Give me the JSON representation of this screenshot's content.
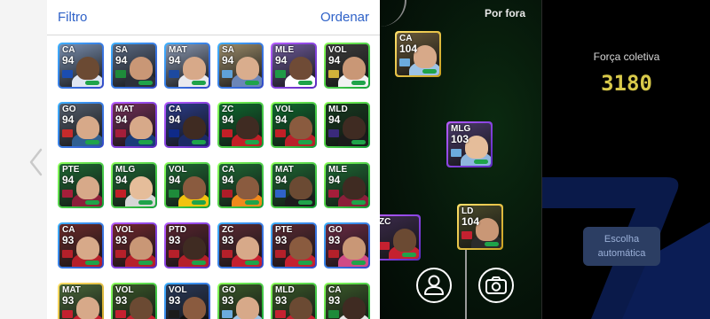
{
  "header": {
    "filter_label": "Filtro",
    "sort_label": "Ordenar"
  },
  "picker": {
    "cards": [
      {
        "pos": "CA",
        "ovr": "94",
        "border": "bd-blue",
        "bg": "#7a8fb0",
        "skin": "#6b4a33",
        "shirt": "#dfe6f2",
        "badge": "#1b4db1"
      },
      {
        "pos": "SA",
        "ovr": "94",
        "border": "bd-blue",
        "bg": "#5b6a83",
        "skin": "#c99776",
        "shirt": "#2b2f3a",
        "badge": "#1e8b3a"
      },
      {
        "pos": "MAT",
        "ovr": "94",
        "border": "bd-blue",
        "bg": "#8b99b3",
        "skin": "#d7a989",
        "shirt": "#e9e9ee",
        "badge": "#1d4aa0"
      },
      {
        "pos": "SA",
        "ovr": "94",
        "border": "bd-blue",
        "bg": "#9c8c6a",
        "skin": "#d9ad8d",
        "shirt": "#6b86b8",
        "badge": "#5fa2d8"
      },
      {
        "pos": "MLE",
        "ovr": "94",
        "border": "bd-purple",
        "bg": "#6f5b9c",
        "skin": "#6f4b36",
        "shirt": "#ffffff",
        "badge": "#1f9a46"
      },
      {
        "pos": "VOL",
        "ovr": "94",
        "border": "bd-green",
        "bg": "#3d3d3d",
        "skin": "#c99776",
        "shirt": "#f2f2f2",
        "badge": "#d1b13a"
      },
      {
        "pos": "GO",
        "ovr": "94",
        "border": "bd-blue",
        "bg": "#555f6e",
        "skin": "#d7a989",
        "shirt": "#2f5f91",
        "badge": "#c62b2b"
      },
      {
        "pos": "MAT",
        "ovr": "94",
        "border": "bd-purple",
        "bg": "#743059",
        "skin": "#d7a989",
        "shirt": "#1a3c7a",
        "badge": "#a41e3a"
      },
      {
        "pos": "CA",
        "ovr": "94",
        "border": "bd-purple",
        "bg": "#2b3c8a",
        "skin": "#3f2b22",
        "shirt": "#1c2a66",
        "badge": "#0f2a88"
      },
      {
        "pos": "ZC",
        "ovr": "94",
        "border": "bd-green",
        "bg": "#0f6a2f",
        "skin": "#3f2b22",
        "shirt": "#c21f27",
        "badge": "#c21f27"
      },
      {
        "pos": "VOL",
        "ovr": "94",
        "border": "bd-green",
        "bg": "#0f6a2f",
        "skin": "#8a5b3f",
        "shirt": "#b8202a",
        "badge": "#c21f27"
      },
      {
        "pos": "MLD",
        "ovr": "94",
        "border": "bd-green",
        "bg": "#163b1f",
        "skin": "#3f2b22",
        "shirt": "#1b1b1b",
        "badge": "#3a2a7a"
      },
      {
        "pos": "PTE",
        "ovr": "94",
        "border": "bd-green",
        "bg": "#1e6a34",
        "skin": "#d7a989",
        "shirt": "#8b1f3a",
        "badge": "#a41e3a"
      },
      {
        "pos": "MLG",
        "ovr": "94",
        "border": "bd-green",
        "bg": "#1e6a34",
        "skin": "#e5bd9a",
        "shirt": "#d6d6d6",
        "badge": "#c21f27"
      },
      {
        "pos": "VOL",
        "ovr": "94",
        "border": "bd-green",
        "bg": "#1e6a34",
        "skin": "#8a5b3f",
        "shirt": "#f1c30e",
        "badge": "#1e8b3a"
      },
      {
        "pos": "CA",
        "ovr": "94",
        "border": "bd-green",
        "bg": "#1e6a34",
        "skin": "#8a5b3f",
        "shirt": "#f08a1c",
        "badge": "#ae1c28"
      },
      {
        "pos": "MAT",
        "ovr": "94",
        "border": "bd-green",
        "bg": "#1e6a34",
        "skin": "#6b4a33",
        "shirt": "#1c1c1c",
        "badge": "#2f62c8"
      },
      {
        "pos": "MLE",
        "ovr": "94",
        "border": "bd-green",
        "bg": "#1e6a34",
        "skin": "#3f2b22",
        "shirt": "#8b1f3a",
        "badge": "#a41e3a"
      },
      {
        "pos": "CA",
        "ovr": "93",
        "border": "bd-blue",
        "bg": "#6c2b2b",
        "skin": "#d7a989",
        "shirt": "#b5202a",
        "badge": "#b5202a"
      },
      {
        "pos": "VOL",
        "ovr": "93",
        "border": "bd-purple",
        "bg": "#742830",
        "skin": "#c99776",
        "shirt": "#b5202a",
        "badge": "#b5202a"
      },
      {
        "pos": "PTD",
        "ovr": "93",
        "border": "bd-purple",
        "bg": "#5a2530",
        "skin": "#3f2b22",
        "shirt": "#b5202a",
        "badge": "#b5202a"
      },
      {
        "pos": "ZC",
        "ovr": "93",
        "border": "bd-blue",
        "bg": "#5c2b34",
        "skin": "#d7a989",
        "shirt": "#c42130",
        "badge": "#b5202a"
      },
      {
        "pos": "PTE",
        "ovr": "93",
        "border": "bd-blue",
        "bg": "#5c2b34",
        "skin": "#8a5b3f",
        "shirt": "#c42130",
        "badge": "#b5202a"
      },
      {
        "pos": "GO",
        "ovr": "93",
        "border": "bd-blue",
        "bg": "#6c2b45",
        "skin": "#c99776",
        "shirt": "#d04a86",
        "badge": "#b5202a"
      },
      {
        "pos": "MAT",
        "ovr": "93",
        "border": "bd-gold",
        "bg": "#4b6a3a",
        "skin": "#d7a989",
        "shirt": "#c42130",
        "badge": "#c42130"
      },
      {
        "pos": "VOL",
        "ovr": "93",
        "border": "bd-green",
        "bg": "#3a5a2a",
        "skin": "#6b4a33",
        "shirt": "#c42130",
        "badge": "#c42130"
      },
      {
        "pos": "VOL",
        "ovr": "93",
        "border": "bd-blue",
        "bg": "#2a3a5a",
        "skin": "#8a5b3f",
        "shirt": "#111111",
        "badge": "#1b1b1b"
      },
      {
        "pos": "GO",
        "ovr": "93",
        "border": "bd-green",
        "bg": "#3a5a2a",
        "skin": "#d7a989",
        "shirt": "#9dc3e6",
        "badge": "#6cabdd"
      },
      {
        "pos": "MLD",
        "ovr": "93",
        "border": "bd-green",
        "bg": "#3a5a2a",
        "skin": "#6b4a33",
        "shirt": "#c42130",
        "badge": "#c42130"
      },
      {
        "pos": "CA",
        "ovr": "93",
        "border": "bd-green",
        "bg": "#3a5a2a",
        "skin": "#3f2b22",
        "shirt": "#e6e6e6",
        "badge": "#1e8b3a"
      }
    ]
  },
  "pitch": {
    "cards": [
      {
        "pos": "CA",
        "ovr": "104",
        "border": "bd-gold",
        "bg": "#6a5a3a",
        "skin": "#d7a989",
        "shirt": "#9dc3e6",
        "badge": "#6cabdd"
      },
      {
        "pos": "MLG",
        "ovr": "103",
        "border": "bd-purple",
        "bg": "#4a3a6a",
        "skin": "#e5bd9a",
        "shirt": "#8fb6de",
        "badge": "#6cabdd"
      },
      {
        "pos": "ZC",
        "ovr": "",
        "border": "bd-purple",
        "bg": "#3a2a4a",
        "skin": "#6b4a33",
        "shirt": "#c42130",
        "badge": "#c42130"
      },
      {
        "pos": "LD",
        "ovr": "104",
        "border": "bd-gold",
        "bg": "#4a4a2a",
        "skin": "#c99776",
        "shirt": "#2b2b2b",
        "badge": "#c42130"
      }
    ],
    "out_label": "Por fora"
  },
  "right_panel": {
    "strength_label": "Força coletiva",
    "strength_value": "3180",
    "auto_button": "Escolha automática"
  },
  "icons": {
    "back": "chevron-left-icon",
    "profile": "person-icon",
    "camera": "camera-icon"
  }
}
